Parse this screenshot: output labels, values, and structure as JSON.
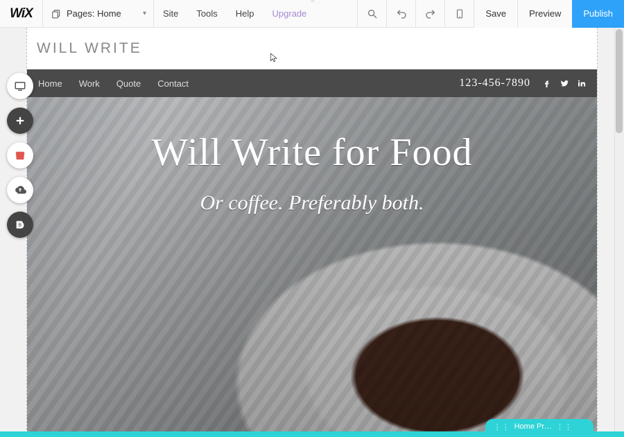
{
  "editor": {
    "logo": "WiX",
    "pages_dropdown": {
      "label": "Pages: Home"
    },
    "menus": {
      "site": "Site",
      "tools": "Tools",
      "help": "Help",
      "upgrade": "Upgrade"
    },
    "actions": {
      "save": "Save",
      "preview": "Preview",
      "publish": "Publish"
    }
  },
  "site": {
    "header_title": "WILL WRITE",
    "nav": {
      "items": [
        "Home",
        "Work",
        "Quote",
        "Contact"
      ],
      "phone": "123-456-7890"
    },
    "hero": {
      "title": "Will Write for Food",
      "tagline": "Or coffee. Preferably both."
    }
  },
  "section_indicator": {
    "label": "Home Pr…"
  }
}
